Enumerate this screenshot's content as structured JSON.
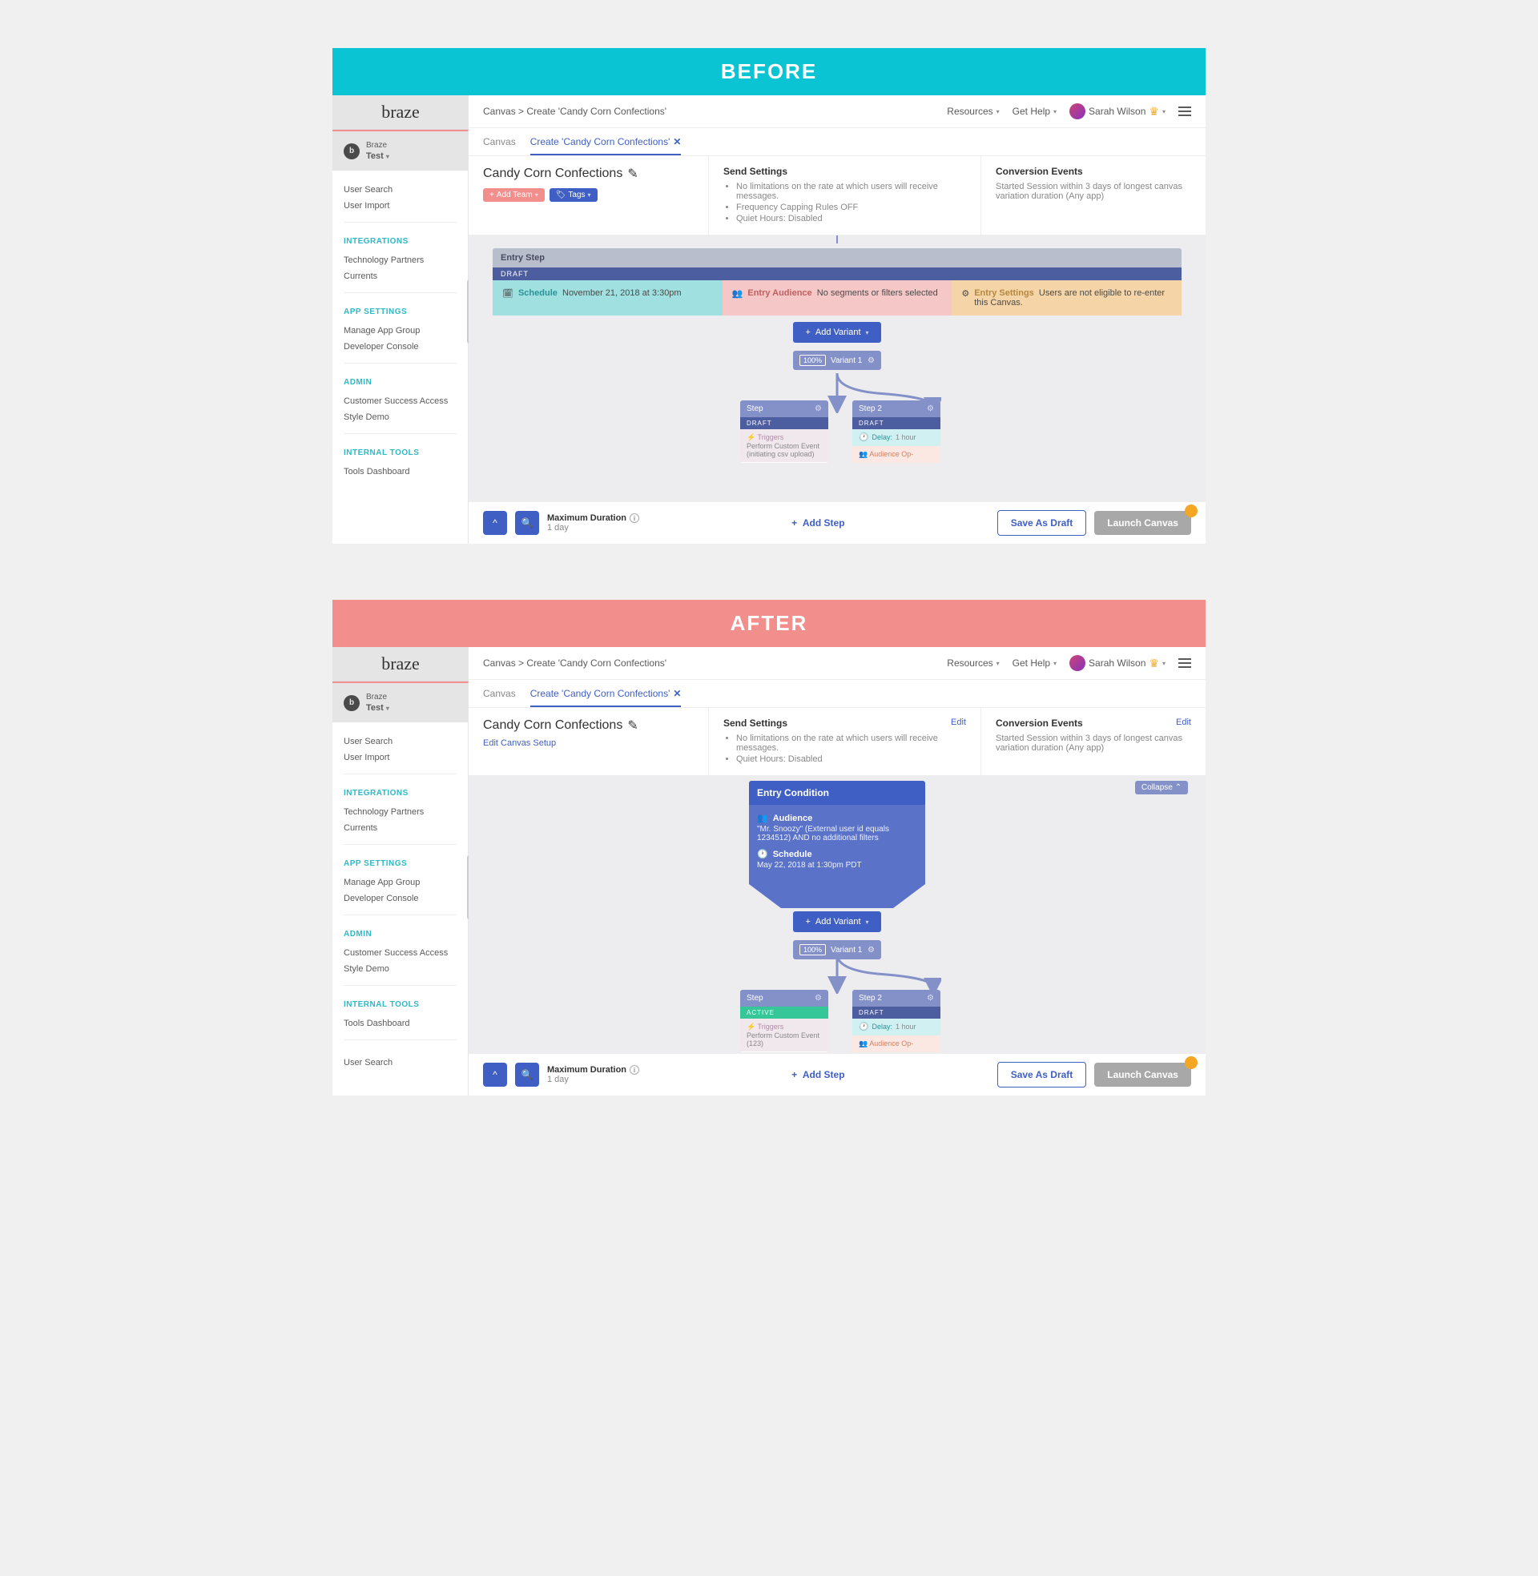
{
  "labels": {
    "before": "BEFORE",
    "after": "AFTER"
  },
  "brand": "braze",
  "sidebar": {
    "org_name": "Braze",
    "selector": "Test",
    "sections": [
      {
        "heading": "",
        "items": [
          "User Search",
          "User Import"
        ]
      },
      {
        "heading": "INTEGRATIONS",
        "items": [
          "Technology Partners",
          "Currents"
        ]
      },
      {
        "heading": "APP SETTINGS",
        "items": [
          "Manage App Group",
          "Developer Console"
        ]
      },
      {
        "heading": "ADMIN",
        "items": [
          "Customer Success Access",
          "Style Demo"
        ]
      },
      {
        "heading": "INTERNAL TOOLS",
        "items": [
          "Tools Dashboard"
        ]
      }
    ],
    "extra_after": [
      "User Search"
    ]
  },
  "topbar": {
    "breadcrumb": "Canvas > Create 'Candy Corn Confections'",
    "resources": "Resources",
    "get_help": "Get Help",
    "user": "Sarah Wilson"
  },
  "tabs": {
    "canvas": "Canvas",
    "create": "Create 'Candy Corn Confections'"
  },
  "summary": {
    "title": "Candy Corn Confections",
    "add_team": "Add Team",
    "tags": "Tags",
    "edit_link": "Edit",
    "edit_canvas_setup": "Edit Canvas Setup",
    "send_heading": "Send Settings",
    "send_items_before": [
      "No limitations on the rate at which users will receive messages.",
      "Frequency Capping Rules OFF",
      "Quiet Hours: Disabled"
    ],
    "send_items_after": [
      "No limitations on the rate at which users will receive messages.",
      "Quiet Hours: Disabled"
    ],
    "conv_heading": "Conversion Events",
    "conv_text": "Started Session within 3 days of longest canvas variation duration (Any app)"
  },
  "entry_before": {
    "title": "Entry Step",
    "status": "DRAFT",
    "schedule_label": "Schedule",
    "schedule_text": "November 21, 2018 at 3:30pm",
    "audience_label": "Entry Audience",
    "audience_text": "No segments or filters selected",
    "settings_label": "Entry Settings",
    "settings_text": "Users are not eligible to re-enter this Canvas."
  },
  "entry_after": {
    "title": "Entry Condition",
    "audience_label": "Audience",
    "audience_text": "\"Mr. Snoozy\" (External user id equals 1234512) AND no additional filters",
    "schedule_label": "Schedule",
    "schedule_text": "May 22, 2018 at 1:30pm PDT"
  },
  "flow": {
    "add_variant": "Add Variant",
    "variant_percent": "100%",
    "variant_name": "Variant 1",
    "collapse": "Collapse"
  },
  "step_before_1": {
    "name": "Step",
    "status": "DRAFT",
    "trigger_label": "Triggers",
    "trigger_text": "Perform Custom Event (initiating csv upload)"
  },
  "step_before_2": {
    "name": "Step 2",
    "status": "DRAFT",
    "delay_label": "Delay:",
    "delay_text": "1 hour",
    "audop": "Audience Op-"
  },
  "step_after_1": {
    "name": "Step",
    "status": "ACTIVE",
    "trigger_label": "Triggers",
    "trigger_text": "Perform Custom Event (123)"
  },
  "step_after_2": {
    "name": "Step 2",
    "status": "DRAFT",
    "delay_label": "Delay:",
    "delay_text": "1 hour",
    "audop": "Audience Op-"
  },
  "bottom": {
    "duration_label": "Maximum Duration",
    "duration_value": "1 day",
    "add_step": "Add Step",
    "save": "Save As Draft",
    "launch": "Launch Canvas"
  }
}
